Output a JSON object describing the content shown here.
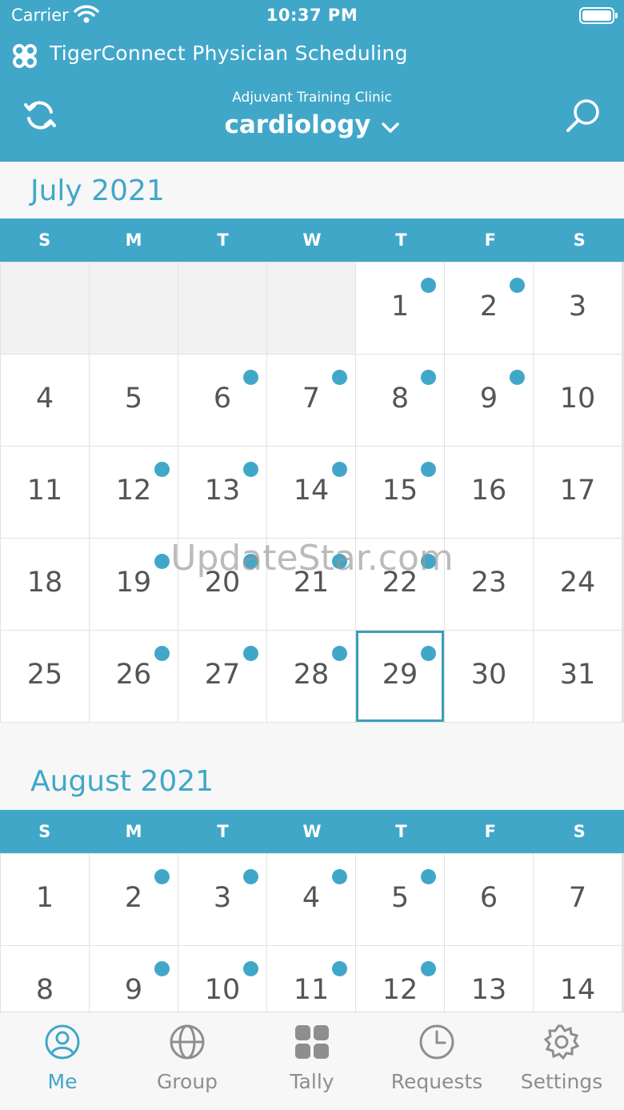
{
  "status_bar": {
    "carrier": "Carrier",
    "time": "10:37 PM"
  },
  "app": {
    "title": "TigerConnect Physician Scheduling"
  },
  "nav": {
    "clinic": "Adjuvant Training Clinic",
    "department": "cardiology"
  },
  "colors": {
    "accent": "#41a7c9",
    "today_border": "#3c9fb7"
  },
  "weekdays": [
    "S",
    "M",
    "T",
    "W",
    "T",
    "F",
    "S"
  ],
  "months": [
    {
      "title": "July 2021",
      "weeks": [
        [
          {
            "d": ""
          },
          {
            "d": ""
          },
          {
            "d": ""
          },
          {
            "d": ""
          },
          {
            "d": "1",
            "dot": true
          },
          {
            "d": "2",
            "dot": true
          },
          {
            "d": "3"
          }
        ],
        [
          {
            "d": "4"
          },
          {
            "d": "5"
          },
          {
            "d": "6",
            "dot": true
          },
          {
            "d": "7",
            "dot": true
          },
          {
            "d": "8",
            "dot": true
          },
          {
            "d": "9",
            "dot": true
          },
          {
            "d": "10"
          }
        ],
        [
          {
            "d": "11"
          },
          {
            "d": "12",
            "dot": true
          },
          {
            "d": "13",
            "dot": true
          },
          {
            "d": "14",
            "dot": true
          },
          {
            "d": "15",
            "dot": true
          },
          {
            "d": "16"
          },
          {
            "d": "17"
          }
        ],
        [
          {
            "d": "18"
          },
          {
            "d": "19",
            "dot": true
          },
          {
            "d": "20",
            "dot": true
          },
          {
            "d": "21",
            "dot": true
          },
          {
            "d": "22",
            "dot": true
          },
          {
            "d": "23"
          },
          {
            "d": "24"
          }
        ],
        [
          {
            "d": "25"
          },
          {
            "d": "26",
            "dot": true
          },
          {
            "d": "27",
            "dot": true
          },
          {
            "d": "28",
            "dot": true
          },
          {
            "d": "29",
            "dot": true,
            "today": true
          },
          {
            "d": "30"
          },
          {
            "d": "31"
          }
        ]
      ]
    },
    {
      "title": "August 2021",
      "weeks": [
        [
          {
            "d": "1"
          },
          {
            "d": "2",
            "dot": true
          },
          {
            "d": "3",
            "dot": true
          },
          {
            "d": "4",
            "dot": true
          },
          {
            "d": "5",
            "dot": true
          },
          {
            "d": "6"
          },
          {
            "d": "7"
          }
        ],
        [
          {
            "d": "8"
          },
          {
            "d": "9",
            "dot": true
          },
          {
            "d": "10",
            "dot": true
          },
          {
            "d": "11",
            "dot": true
          },
          {
            "d": "12",
            "dot": true
          },
          {
            "d": "13"
          },
          {
            "d": "14"
          }
        ]
      ]
    }
  ],
  "watermark": "UpdateStar.com",
  "tabs": [
    {
      "label": "Me",
      "icon": "person-icon",
      "active": true
    },
    {
      "label": "Group",
      "icon": "globe-icon"
    },
    {
      "label": "Tally",
      "icon": "grid-icon"
    },
    {
      "label": "Requests",
      "icon": "clock-icon"
    },
    {
      "label": "Settings",
      "icon": "gear-icon"
    }
  ]
}
